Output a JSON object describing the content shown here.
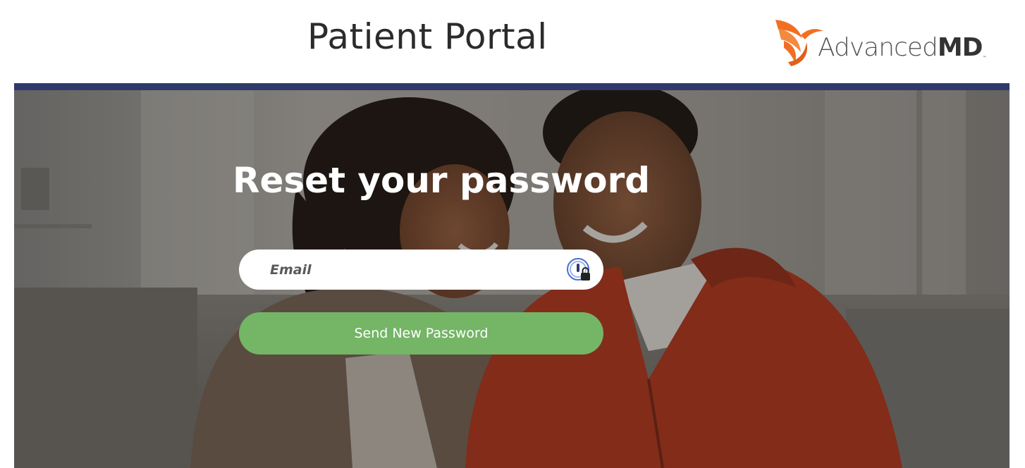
{
  "header": {
    "title": "Patient Portal",
    "logo": {
      "text_light": "Advanced",
      "text_bold": "MD",
      "trademark": "™",
      "brand_color": "#f26f21"
    }
  },
  "hero": {
    "top_bar_color": "#2f3a6b",
    "heading": "Reset your password",
    "email_field": {
      "value": "",
      "placeholder": "Email",
      "password_manager_icon": "password-manager-lock-icon"
    },
    "submit_button": {
      "label": "Send New Password",
      "color": "#74b566"
    },
    "background_image": "couple-smiling-on-couch-photo"
  }
}
